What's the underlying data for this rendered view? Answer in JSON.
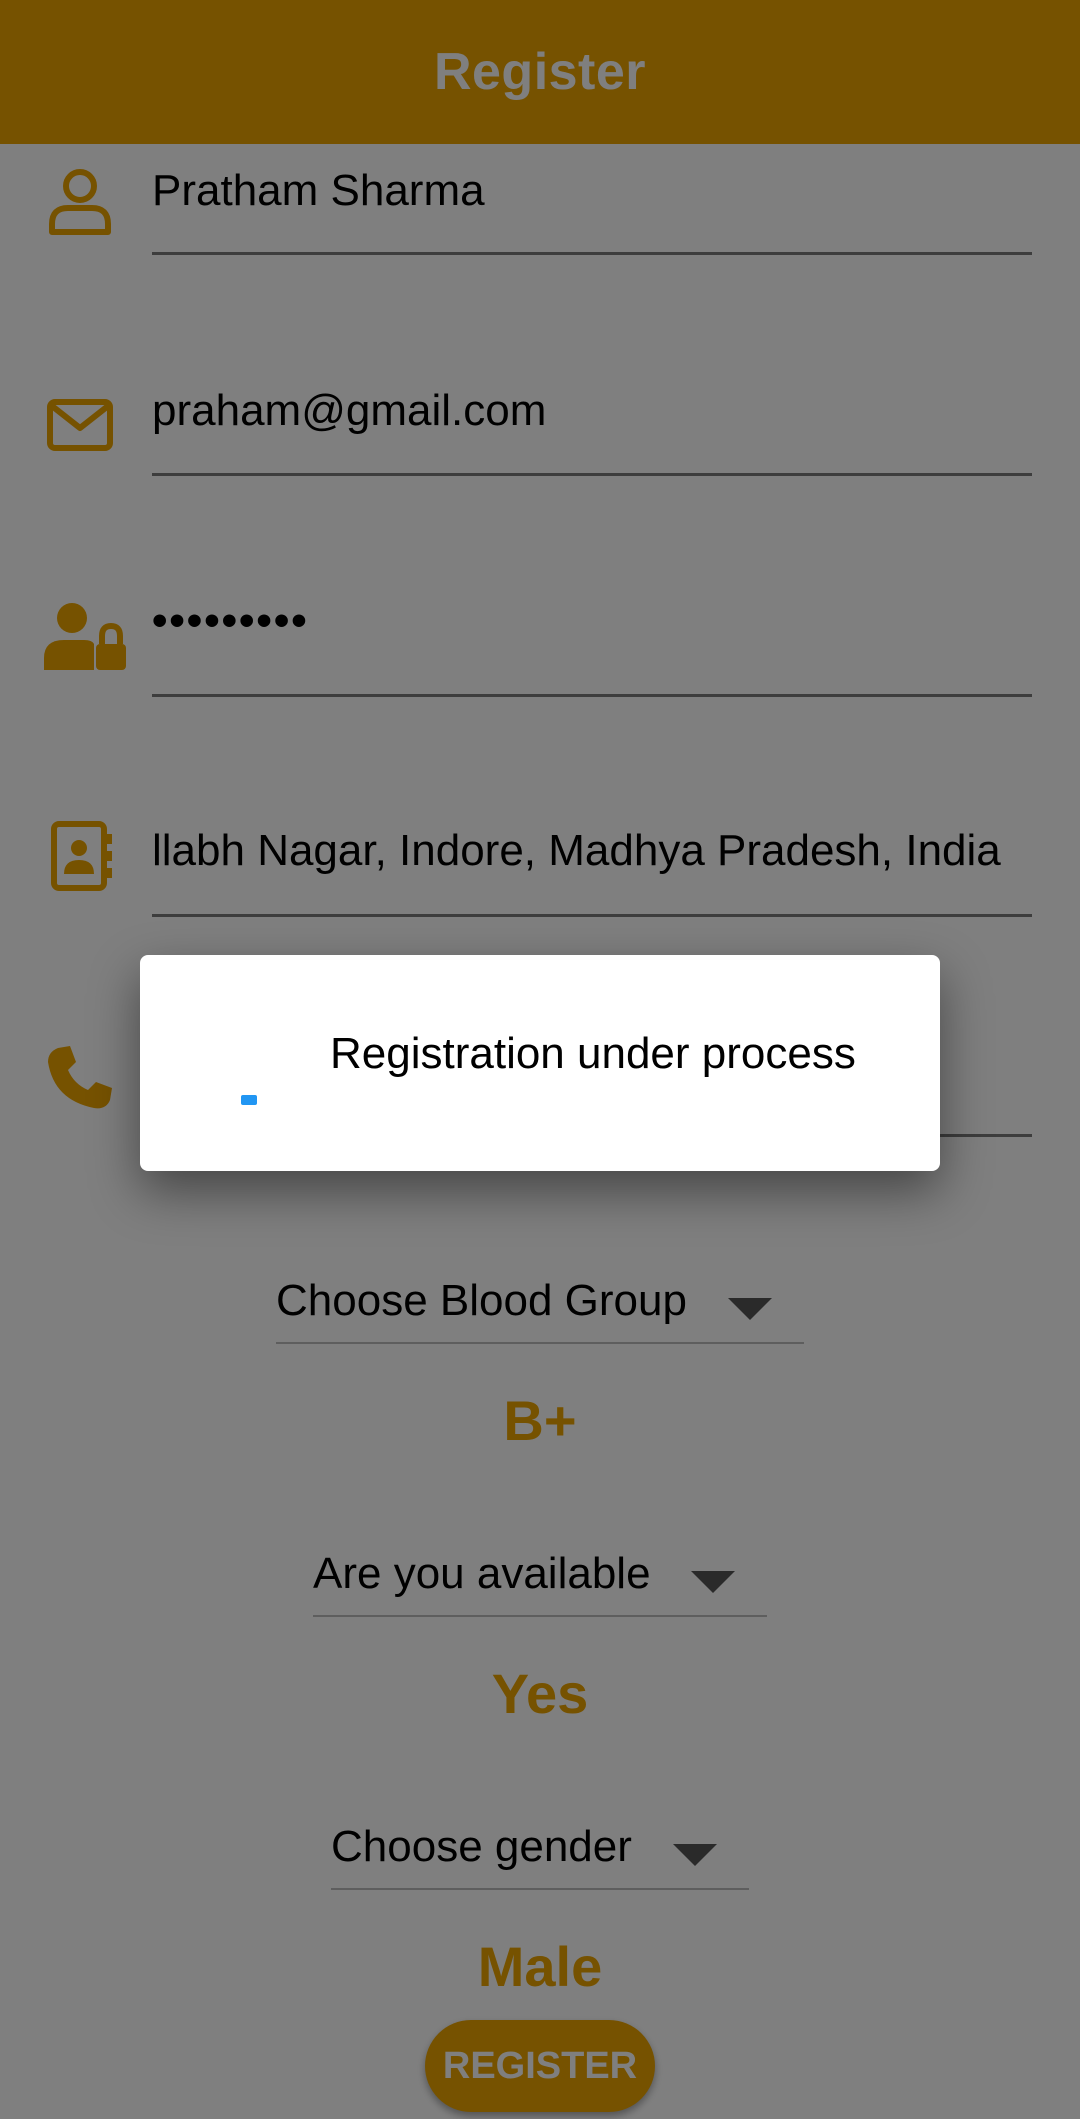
{
  "appbar": {
    "title": "Register"
  },
  "form": {
    "name": "Pratham Sharma",
    "email": "praham@gmail.com",
    "password_masked": "•••••••••",
    "address": "llabh Nagar, Indore, Madhya Pradesh, India",
    "blood_group": {
      "label": "Choose Blood Group",
      "selected": "B+"
    },
    "availability": {
      "label": "Are you available",
      "selected": "Yes"
    },
    "gender": {
      "label": "Choose gender",
      "selected": "Male"
    },
    "register_label": "REGISTER"
  },
  "dialog": {
    "message": "Registration under process"
  },
  "colors": {
    "accent": "#eda500",
    "progress": "#2196f3",
    "scrim": "rgba(0,0,0,0.5)"
  },
  "icons": {
    "name": "person-outline-icon",
    "email": "envelope-icon",
    "password": "user-lock-icon",
    "address": "address-book-icon",
    "phone": "phone-icon"
  }
}
